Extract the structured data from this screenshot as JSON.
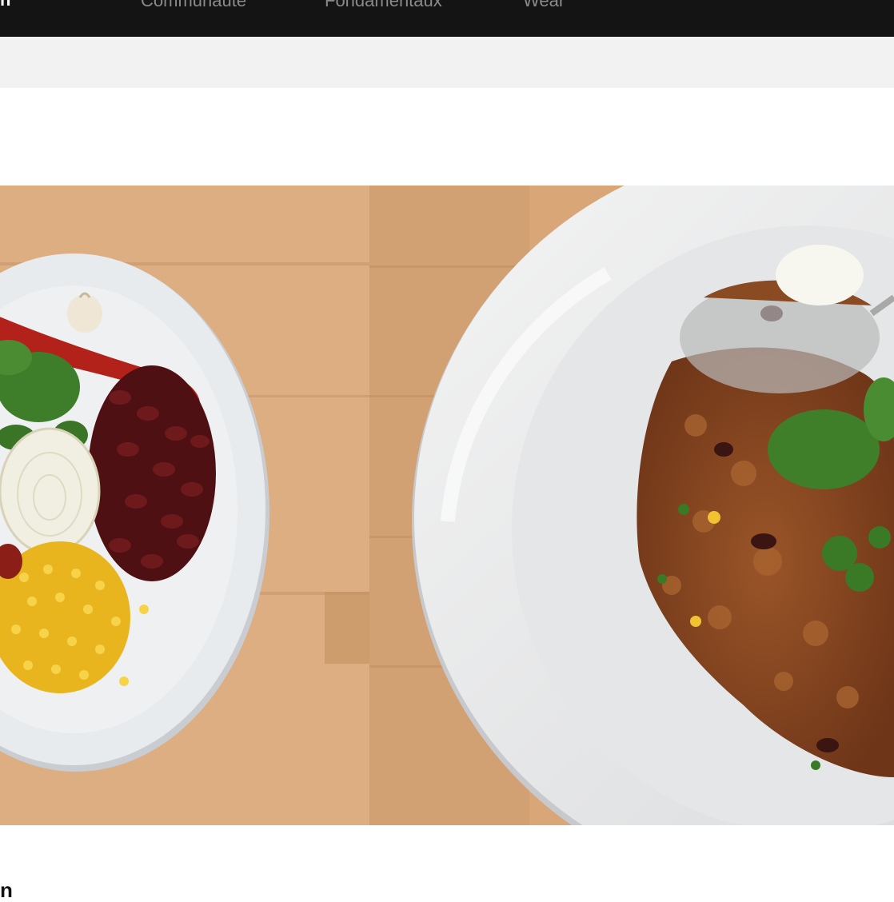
{
  "nav": {
    "brand": "n",
    "links": [
      "Communauté",
      "Fondamentaux",
      "Wear"
    ]
  },
  "hero": {
    "alt": "Chili con carne ingredients on a plate next to the finished dish",
    "colors": {
      "wood": "#d9a87a",
      "plate": "#e9ecef",
      "beans": "#5a1416",
      "corn": "#f2c230",
      "basil": "#3f7f2a",
      "chili": "#b4231a",
      "stew": "#8a4a22"
    }
  },
  "article": {
    "title_fragment": "n"
  }
}
